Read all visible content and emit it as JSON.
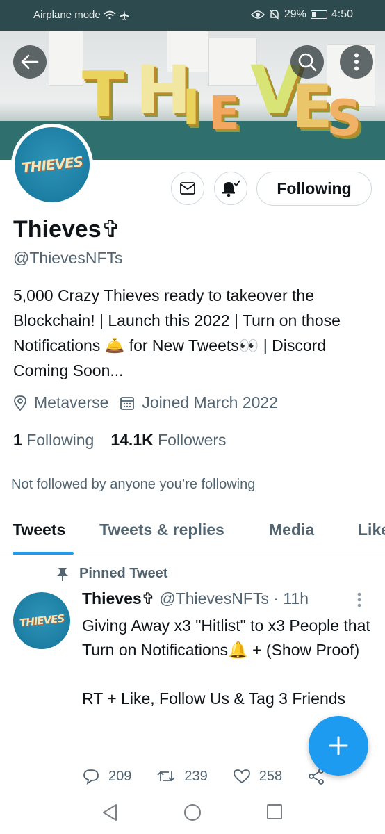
{
  "status_bar": {
    "mode": "Airplane mode",
    "battery": "29%",
    "time": "4:50"
  },
  "banner": {
    "letters": [
      "T",
      "H",
      "I",
      "E",
      "V",
      "E",
      "S"
    ]
  },
  "header": {
    "back_icon": "back-arrow-icon",
    "search_icon": "search-icon",
    "more_icon": "more-vertical-icon"
  },
  "avatar": {
    "logo_text": "THIEVES"
  },
  "actions": {
    "message_icon": "envelope-icon",
    "notify_icon": "bell-check-icon",
    "following_label": "Following"
  },
  "profile": {
    "name": "Thieves✞",
    "handle": "@ThievesNFTs",
    "bio": "5,000 Crazy Thieves ready to takeover the Blockchain! | Launch this 2022 | Turn on those Notifications 🛎️ for New Tweets👀 | Discord Coming Soon...",
    "location": "Metaverse",
    "joined": "Joined March 2022",
    "following_count": "1",
    "following_label": "Following",
    "followers_count": "14.1K",
    "followers_label": "Followers",
    "not_followed": "Not followed by anyone you’re following"
  },
  "tabs": [
    {
      "label": "Tweets"
    },
    {
      "label": "Tweets & replies"
    },
    {
      "label": "Media"
    },
    {
      "label": "Likes"
    }
  ],
  "tweet": {
    "pinned_label": "Pinned Tweet",
    "author_name": "Thieves✞",
    "author_handle": "@ThievesNFTs",
    "separator": "·",
    "time": "11h",
    "body": "Giving Away x3 \"Hitlist\" to x3 People that Turn on Notifications🔔 + (Show Proof)\n\nRT + Like, Follow Us & Tag 3 Friends",
    "replies": "209",
    "retweets": "239",
    "likes": "258"
  },
  "colors": {
    "accent": "#1d9bf0",
    "text": "#0f1419",
    "secondary": "#536471",
    "statusbar": "#2d4a4e"
  }
}
